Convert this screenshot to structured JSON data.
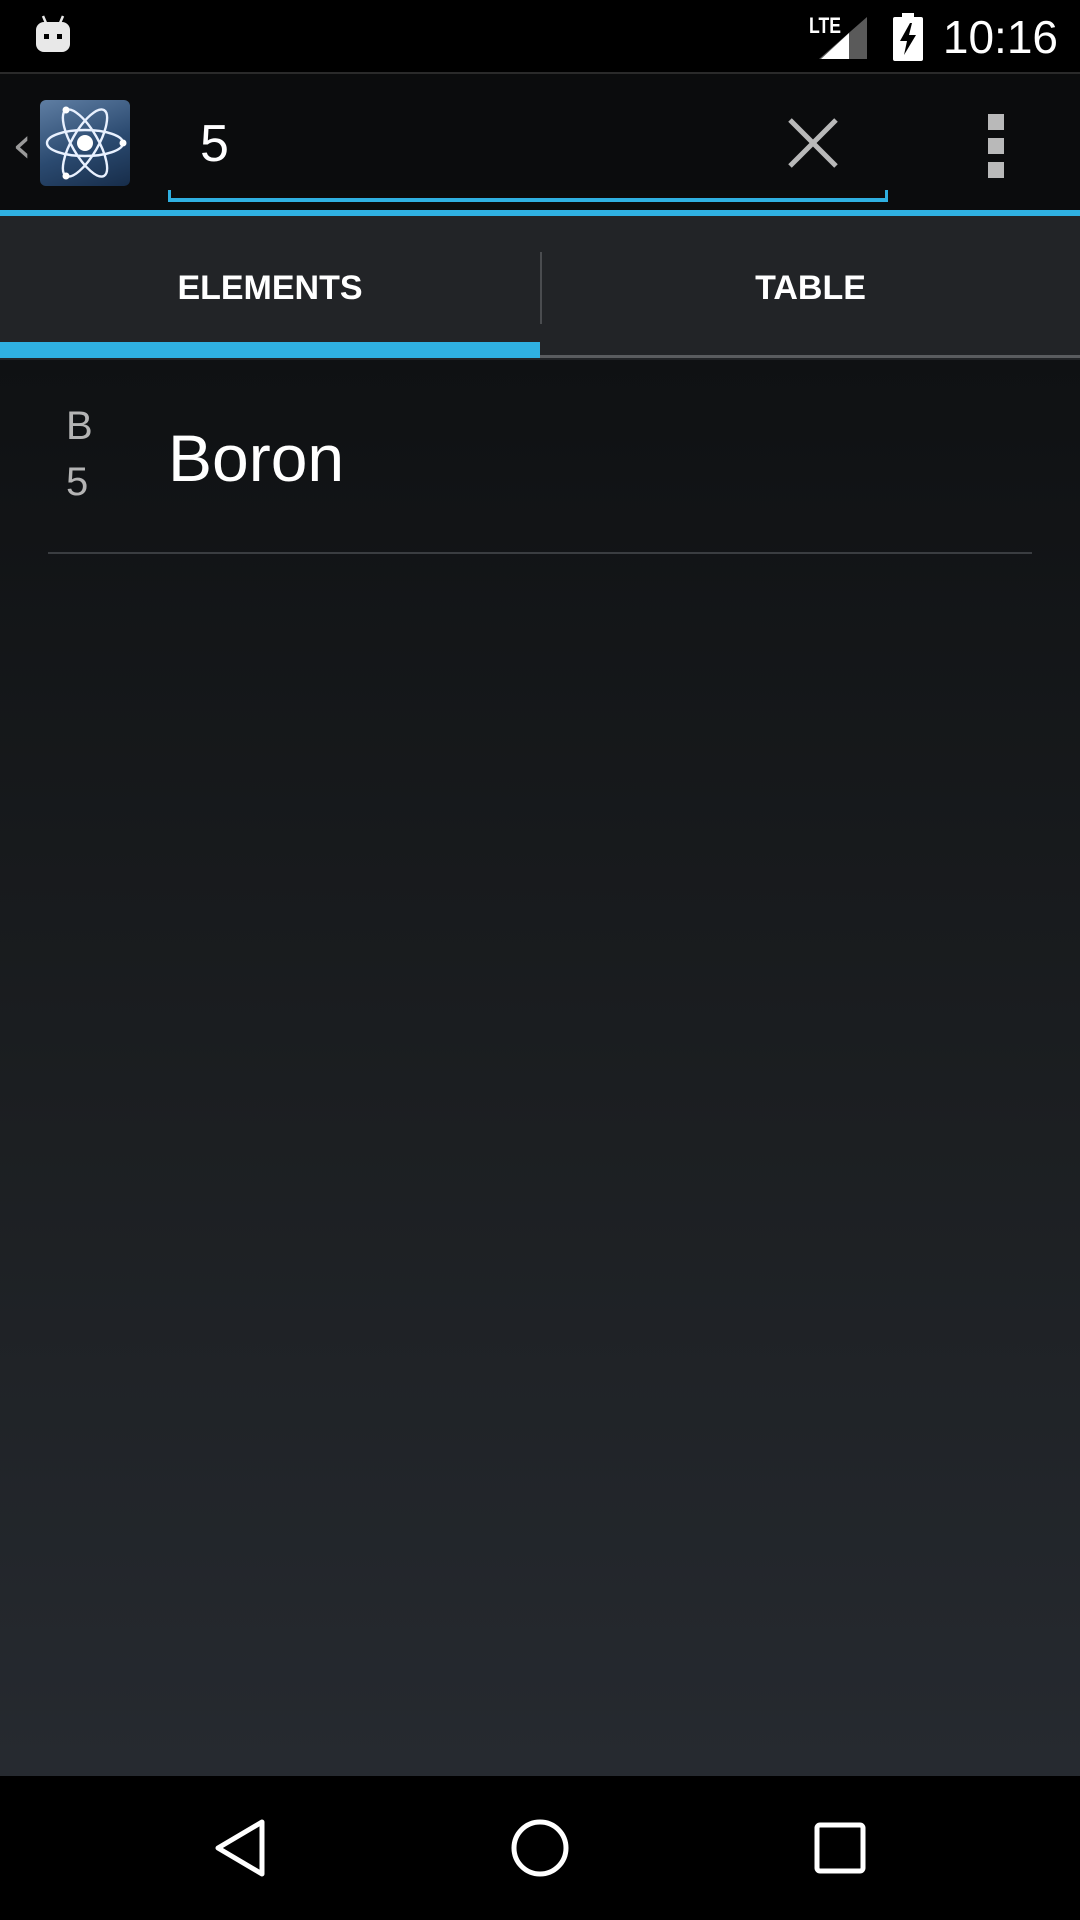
{
  "status_bar": {
    "network_label": "LTE",
    "time": "10:16",
    "icons": [
      "android-notification-icon",
      "lte-signal-icon",
      "battery-charging-icon"
    ]
  },
  "action_bar": {
    "up_icon": "chevron-left-icon",
    "app_icon": "atom-icon",
    "search": {
      "value": "5"
    },
    "clear_icon": "close-icon",
    "overflow_icon": "overflow-menu-icon"
  },
  "tabs": [
    {
      "label": "ELEMENTS",
      "selected": true
    },
    {
      "label": "TABLE",
      "selected": false
    }
  ],
  "elements": [
    {
      "symbol": "B",
      "number": "5",
      "name": "Boron"
    }
  ],
  "nav_bar": {
    "icons": [
      "back-icon",
      "home-icon",
      "recents-icon"
    ]
  },
  "colors": {
    "accent": "#2fb0e1",
    "tab_background": "#222427",
    "action_bar_background": "#0b0c0d"
  }
}
